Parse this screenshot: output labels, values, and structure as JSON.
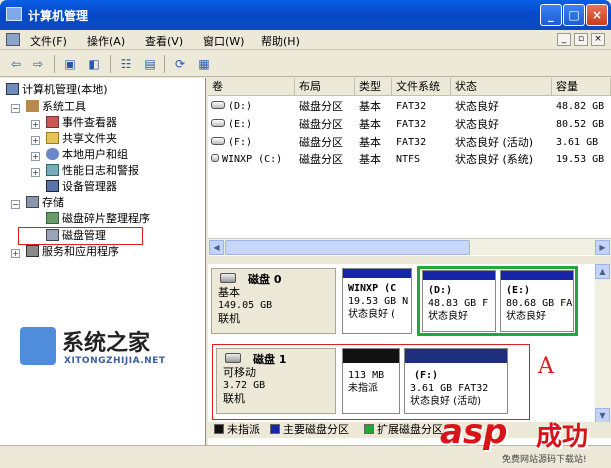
{
  "window": {
    "title": "计算机管理",
    "buttons": {
      "minimize": "_",
      "maximize": "□",
      "close": "×"
    }
  },
  "menu": {
    "items": [
      {
        "label": "文件(F)"
      },
      {
        "label": "操作(A)"
      },
      {
        "label": "查看(V)"
      },
      {
        "label": "窗口(W)"
      },
      {
        "label": "帮助(H)"
      }
    ],
    "mdi": {
      "minimize": "_",
      "restore": "▫",
      "close": "×"
    }
  },
  "tree": {
    "root": "计算机管理(本地)",
    "system_tools": "系统工具",
    "event_viewer": "事件查看器",
    "shared_folders": "共享文件夹",
    "local_users": "本地用户和组",
    "perf_logs": "性能日志和警报",
    "device_manager": "设备管理器",
    "storage": "存储",
    "defrag": "磁盘碎片整理程序",
    "disk_mgmt": "磁盘管理",
    "services": "服务和应用程序"
  },
  "volume_list": {
    "columns": [
      "卷",
      "布局",
      "类型",
      "文件系统",
      "状态",
      "容量"
    ],
    "rows": [
      {
        "vol": "(D:)",
        "layout": "磁盘分区",
        "type": "基本",
        "fs": "FAT32",
        "status": "状态良好",
        "cap": "48.82 GB"
      },
      {
        "vol": "(E:)",
        "layout": "磁盘分区",
        "type": "基本",
        "fs": "FAT32",
        "status": "状态良好",
        "cap": "80.52 GB"
      },
      {
        "vol": "(F:)",
        "layout": "磁盘分区",
        "type": "基本",
        "fs": "FAT32",
        "status": "状态良好 (活动)",
        "cap": "3.61 GB"
      },
      {
        "vol": "WINXP (C:)",
        "layout": "磁盘分区",
        "type": "基本",
        "fs": "NTFS",
        "status": "状态良好 (系统)",
        "cap": "19.53 GB"
      }
    ]
  },
  "disks": {
    "disk0": {
      "name": "磁盘 0",
      "kind": "基本",
      "size": "149.05 GB",
      "state": "联机",
      "partitions": [
        {
          "name": "WINXP (C",
          "size": "19.53 GB N",
          "status": "状态良好 ("
        },
        {
          "name": "(D:)",
          "size": "48.83 GB F",
          "status": "状态良好"
        },
        {
          "name": "(E:)",
          "size": "80.68 GB FA",
          "status": "状态良好"
        }
      ]
    },
    "disk1": {
      "name": "磁盘 1",
      "kind": "可移动",
      "size": "3.72 GB",
      "state": "联机",
      "partitions": [
        {
          "size": "113 MB",
          "status": "未指派"
        },
        {
          "name": "(F:)",
          "size": "3.61 GB FAT32",
          "status": "状态良好 (活动)"
        }
      ]
    }
  },
  "annotation_label": "A",
  "legend": {
    "unallocated": "未指派",
    "primary": "主要磁盘分区",
    "extended": "扩展磁盘分区"
  },
  "watermarks": {
    "left_title": "系统之家",
    "left_sub": "XITONGZHIJIA.NET",
    "right_brand": "asp",
    "right_cn": "成功",
    "right_foot": "免费网站源码下载站!"
  },
  "colors": {
    "primary_bar": "#1726A8",
    "unallocated_bar": "#111111",
    "extended_frame": "#22A83A",
    "annotation": "#E02020"
  }
}
